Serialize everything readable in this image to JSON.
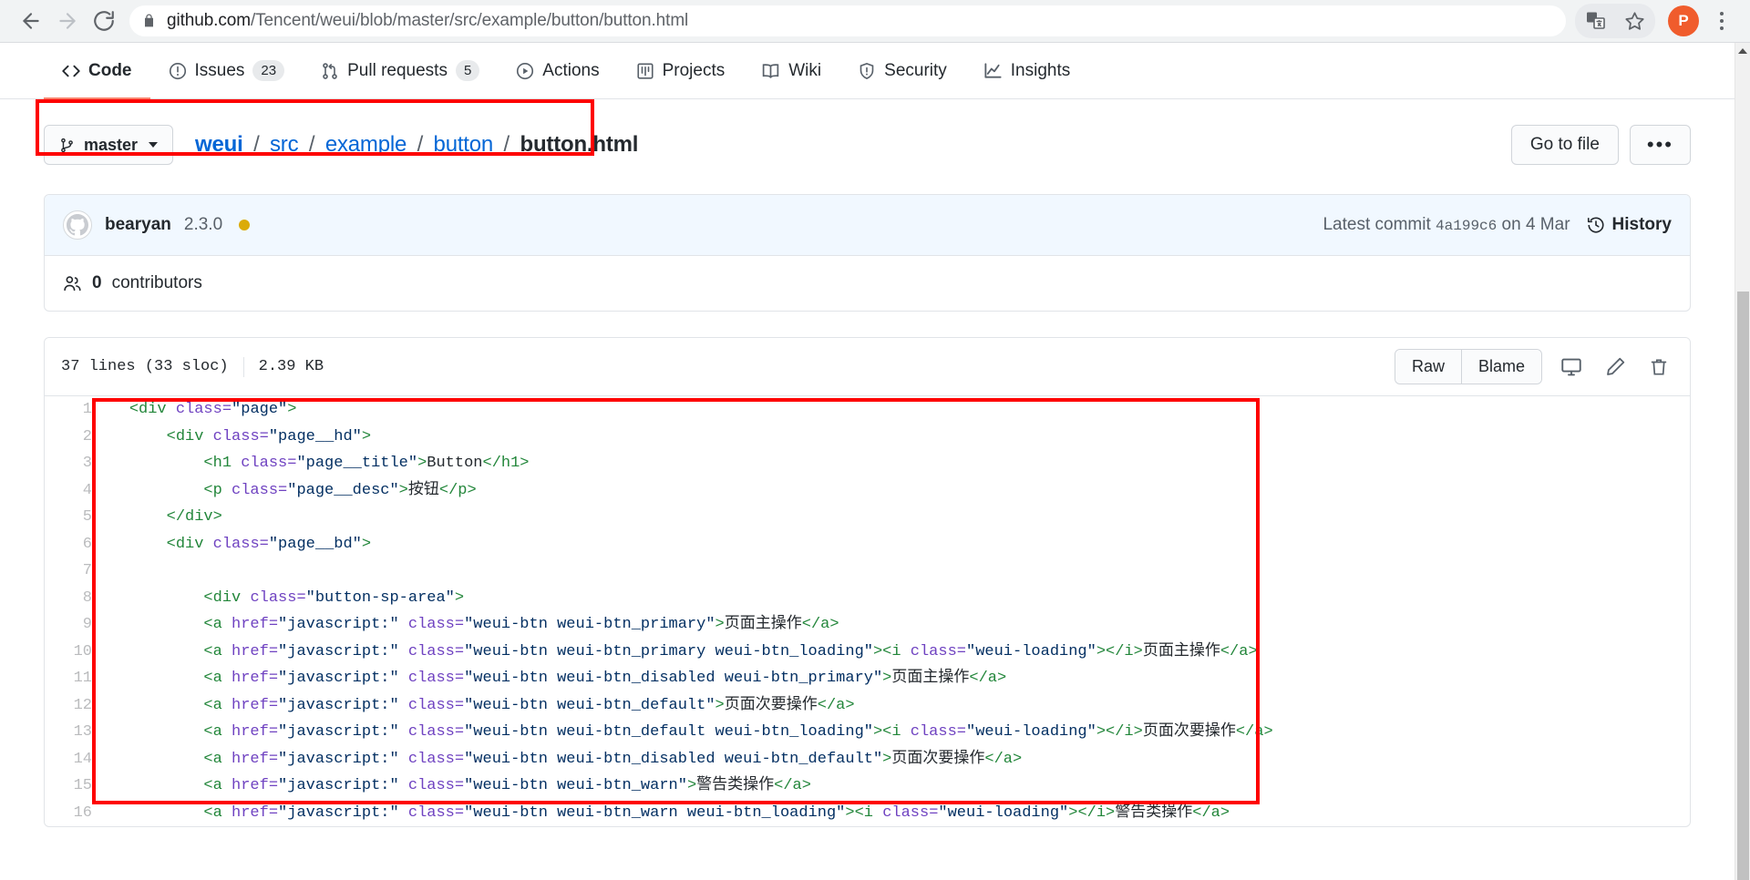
{
  "browser": {
    "back_icon": "back-arrow-icon",
    "forward_icon": "forward-arrow-icon",
    "reload_icon": "reload-icon",
    "lock_icon": "lock-icon",
    "url_host": "github.com",
    "url_path": "/Tencent/weui/blob/master/src/example/button/button.html",
    "url_full": "github.com/Tencent/weui/blob/master/src/example/button/button.html",
    "translate_icon": "translate-icon",
    "bookmark_icon": "star-icon",
    "profile_initial": "P",
    "profile_color": "#f05c2c",
    "menu_icon": "kebab-menu-icon"
  },
  "repo_nav": {
    "items": [
      {
        "label": "Code",
        "icon": "code-icon",
        "count": "",
        "active": true
      },
      {
        "label": "Issues",
        "icon": "issue-opened-icon",
        "count": "23",
        "active": false
      },
      {
        "label": "Pull requests",
        "icon": "git-pull-request-icon",
        "count": "5",
        "active": false
      },
      {
        "label": "Actions",
        "icon": "play-icon",
        "count": "",
        "active": false
      },
      {
        "label": "Projects",
        "icon": "project-board-icon",
        "count": "",
        "active": false
      },
      {
        "label": "Wiki",
        "icon": "book-icon",
        "count": "",
        "active": false
      },
      {
        "label": "Security",
        "icon": "shield-icon",
        "count": "",
        "active": false
      },
      {
        "label": "Insights",
        "icon": "graph-icon",
        "count": "",
        "active": false
      }
    ],
    "active_accent": "#f9826c"
  },
  "file_header": {
    "branch_label": "master",
    "branch_icon": "git-branch-icon",
    "breadcrumb": [
      {
        "label": "weui",
        "link": true,
        "bold": true
      },
      {
        "label": "src",
        "link": true,
        "bold": false
      },
      {
        "label": "example",
        "link": true,
        "bold": false
      },
      {
        "label": "button",
        "link": true,
        "bold": false
      },
      {
        "label": "button.html",
        "link": false,
        "bold": true
      }
    ],
    "separator": "/",
    "go_to_file_label": "Go to file",
    "more_label": "•••"
  },
  "commit": {
    "avatar_icon": "octocat-avatar",
    "author": "bearyan",
    "message": "2.3.0",
    "status_dot_color": "#dbab09",
    "latest_commit_prefix": "Latest commit",
    "sha": "4a199c6",
    "date_prefix": "on",
    "date": "4 Mar",
    "history_label": "History",
    "history_icon": "history-clock-icon",
    "contributors_icon": "people-icon",
    "contributors_count": "0",
    "contributors_label": "contributors"
  },
  "file_toolbar": {
    "lines": "37 lines (33 sloc)",
    "size": "2.39 KB",
    "raw_label": "Raw",
    "blame_label": "Blame",
    "open_desktop_icon": "desktop-download-icon",
    "edit_icon": "pencil-icon",
    "delete_icon": "trash-icon"
  },
  "code": {
    "language": "html",
    "lines": [
      {
        "n": "1",
        "tokens": [
          {
            "c": "x",
            "v": "    "
          },
          {
            "c": "t",
            "v": "<div "
          },
          {
            "c": "a",
            "v": "class="
          },
          {
            "c": "s",
            "v": "\"page\""
          },
          {
            "c": "t",
            "v": ">"
          }
        ]
      },
      {
        "n": "2",
        "tokens": [
          {
            "c": "x",
            "v": "        "
          },
          {
            "c": "t",
            "v": "<div "
          },
          {
            "c": "a",
            "v": "class="
          },
          {
            "c": "s",
            "v": "\"page__hd\""
          },
          {
            "c": "t",
            "v": ">"
          }
        ]
      },
      {
        "n": "3",
        "tokens": [
          {
            "c": "x",
            "v": "            "
          },
          {
            "c": "t",
            "v": "<h1 "
          },
          {
            "c": "a",
            "v": "class="
          },
          {
            "c": "s",
            "v": "\"page__title\""
          },
          {
            "c": "t",
            "v": ">"
          },
          {
            "c": "x",
            "v": "Button"
          },
          {
            "c": "t",
            "v": "</h1>"
          }
        ]
      },
      {
        "n": "4",
        "tokens": [
          {
            "c": "x",
            "v": "            "
          },
          {
            "c": "t",
            "v": "<p "
          },
          {
            "c": "a",
            "v": "class="
          },
          {
            "c": "s",
            "v": "\"page__desc\""
          },
          {
            "c": "t",
            "v": ">"
          },
          {
            "c": "x",
            "v": "按钮"
          },
          {
            "c": "t",
            "v": "</p>"
          }
        ]
      },
      {
        "n": "5",
        "tokens": [
          {
            "c": "x",
            "v": "        "
          },
          {
            "c": "t",
            "v": "</div>"
          }
        ]
      },
      {
        "n": "6",
        "tokens": [
          {
            "c": "x",
            "v": "        "
          },
          {
            "c": "t",
            "v": "<div "
          },
          {
            "c": "a",
            "v": "class="
          },
          {
            "c": "s",
            "v": "\"page__bd\""
          },
          {
            "c": "t",
            "v": ">"
          }
        ]
      },
      {
        "n": "7",
        "tokens": [
          {
            "c": "x",
            "v": ""
          }
        ]
      },
      {
        "n": "8",
        "tokens": [
          {
            "c": "x",
            "v": "            "
          },
          {
            "c": "t",
            "v": "<div "
          },
          {
            "c": "a",
            "v": "class="
          },
          {
            "c": "s",
            "v": "\"button-sp-area\""
          },
          {
            "c": "t",
            "v": ">"
          }
        ]
      },
      {
        "n": "9",
        "tokens": [
          {
            "c": "x",
            "v": "            "
          },
          {
            "c": "t",
            "v": "<a "
          },
          {
            "c": "a",
            "v": "href="
          },
          {
            "c": "s",
            "v": "\"javascript:\""
          },
          {
            "c": "a",
            "v": " class="
          },
          {
            "c": "s",
            "v": "\"weui-btn weui-btn_primary\""
          },
          {
            "c": "t",
            "v": ">"
          },
          {
            "c": "x",
            "v": "页面主操作"
          },
          {
            "c": "t",
            "v": "</a>"
          }
        ]
      },
      {
        "n": "10",
        "tokens": [
          {
            "c": "x",
            "v": "            "
          },
          {
            "c": "t",
            "v": "<a "
          },
          {
            "c": "a",
            "v": "href="
          },
          {
            "c": "s",
            "v": "\"javascript:\""
          },
          {
            "c": "a",
            "v": " class="
          },
          {
            "c": "s",
            "v": "\"weui-btn weui-btn_primary weui-btn_loading\""
          },
          {
            "c": "t",
            "v": ">"
          },
          {
            "c": "t",
            "v": "<i "
          },
          {
            "c": "a",
            "v": "class="
          },
          {
            "c": "s",
            "v": "\"weui-loading\""
          },
          {
            "c": "t",
            "v": ">"
          },
          {
            "c": "t",
            "v": "</i>"
          },
          {
            "c": "x",
            "v": "页面主操作"
          },
          {
            "c": "t",
            "v": "</a>"
          }
        ]
      },
      {
        "n": "11",
        "tokens": [
          {
            "c": "x",
            "v": "            "
          },
          {
            "c": "t",
            "v": "<a "
          },
          {
            "c": "a",
            "v": "href="
          },
          {
            "c": "s",
            "v": "\"javascript:\""
          },
          {
            "c": "a",
            "v": " class="
          },
          {
            "c": "s",
            "v": "\"weui-btn weui-btn_disabled weui-btn_primary\""
          },
          {
            "c": "t",
            "v": ">"
          },
          {
            "c": "x",
            "v": "页面主操作"
          },
          {
            "c": "t",
            "v": "</a>"
          }
        ]
      },
      {
        "n": "12",
        "tokens": [
          {
            "c": "x",
            "v": "            "
          },
          {
            "c": "t",
            "v": "<a "
          },
          {
            "c": "a",
            "v": "href="
          },
          {
            "c": "s",
            "v": "\"javascript:\""
          },
          {
            "c": "a",
            "v": " class="
          },
          {
            "c": "s",
            "v": "\"weui-btn weui-btn_default\""
          },
          {
            "c": "t",
            "v": ">"
          },
          {
            "c": "x",
            "v": "页面次要操作"
          },
          {
            "c": "t",
            "v": "</a>"
          }
        ]
      },
      {
        "n": "13",
        "tokens": [
          {
            "c": "x",
            "v": "            "
          },
          {
            "c": "t",
            "v": "<a "
          },
          {
            "c": "a",
            "v": "href="
          },
          {
            "c": "s",
            "v": "\"javascript:\""
          },
          {
            "c": "a",
            "v": " class="
          },
          {
            "c": "s",
            "v": "\"weui-btn weui-btn_default weui-btn_loading\""
          },
          {
            "c": "t",
            "v": ">"
          },
          {
            "c": "t",
            "v": "<i "
          },
          {
            "c": "a",
            "v": "class="
          },
          {
            "c": "s",
            "v": "\"weui-loading\""
          },
          {
            "c": "t",
            "v": ">"
          },
          {
            "c": "t",
            "v": "</i>"
          },
          {
            "c": "x",
            "v": "页面次要操作"
          },
          {
            "c": "t",
            "v": "</a>"
          }
        ]
      },
      {
        "n": "14",
        "tokens": [
          {
            "c": "x",
            "v": "            "
          },
          {
            "c": "t",
            "v": "<a "
          },
          {
            "c": "a",
            "v": "href="
          },
          {
            "c": "s",
            "v": "\"javascript:\""
          },
          {
            "c": "a",
            "v": " class="
          },
          {
            "c": "s",
            "v": "\"weui-btn weui-btn_disabled weui-btn_default\""
          },
          {
            "c": "t",
            "v": ">"
          },
          {
            "c": "x",
            "v": "页面次要操作"
          },
          {
            "c": "t",
            "v": "</a>"
          }
        ]
      },
      {
        "n": "15",
        "tokens": [
          {
            "c": "x",
            "v": "            "
          },
          {
            "c": "t",
            "v": "<a "
          },
          {
            "c": "a",
            "v": "href="
          },
          {
            "c": "s",
            "v": "\"javascript:\""
          },
          {
            "c": "a",
            "v": " class="
          },
          {
            "c": "s",
            "v": "\"weui-btn weui-btn_warn\""
          },
          {
            "c": "t",
            "v": ">"
          },
          {
            "c": "x",
            "v": "警告类操作"
          },
          {
            "c": "t",
            "v": "</a>"
          }
        ]
      },
      {
        "n": "16",
        "tokens": [
          {
            "c": "x",
            "v": "            "
          },
          {
            "c": "t",
            "v": "<a "
          },
          {
            "c": "a",
            "v": "href="
          },
          {
            "c": "s",
            "v": "\"javascript:\""
          },
          {
            "c": "a",
            "v": " class="
          },
          {
            "c": "s",
            "v": "\"weui-btn weui-btn_warn weui-btn_loading\""
          },
          {
            "c": "t",
            "v": ">"
          },
          {
            "c": "t",
            "v": "<i "
          },
          {
            "c": "a",
            "v": "class="
          },
          {
            "c": "s",
            "v": "\"weui-loading\""
          },
          {
            "c": "t",
            "v": ">"
          },
          {
            "c": "t",
            "v": "</i>"
          },
          {
            "c": "x",
            "v": "警告类操作"
          },
          {
            "c": "t",
            "v": "</a>"
          }
        ]
      }
    ]
  },
  "annotations": {
    "color": "#fe0000",
    "boxes": [
      "breadcrumb-highlight",
      "code-block-highlight"
    ]
  },
  "scrollbar": {
    "up_arrow_icon": "scroll-up-arrow",
    "down_arrow_icon": "scroll-down-arrow"
  }
}
